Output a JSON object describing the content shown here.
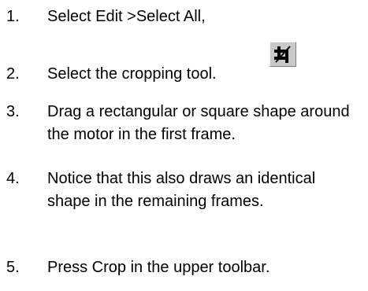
{
  "steps": [
    {
      "number": "1.",
      "text": "Select Edit >Select All,"
    },
    {
      "number": "2.",
      "text": "Select the cropping tool."
    },
    {
      "number": "3.",
      "text": "Drag a rectangular or square shape around the motor in the first frame."
    },
    {
      "number": "4.",
      "text": "Notice that this also draws an identical shape in the remaining frames."
    },
    {
      "number": "5.",
      "text": "Press Crop in the upper toolbar."
    }
  ],
  "icons": {
    "crop_tool": "crop-icon"
  }
}
